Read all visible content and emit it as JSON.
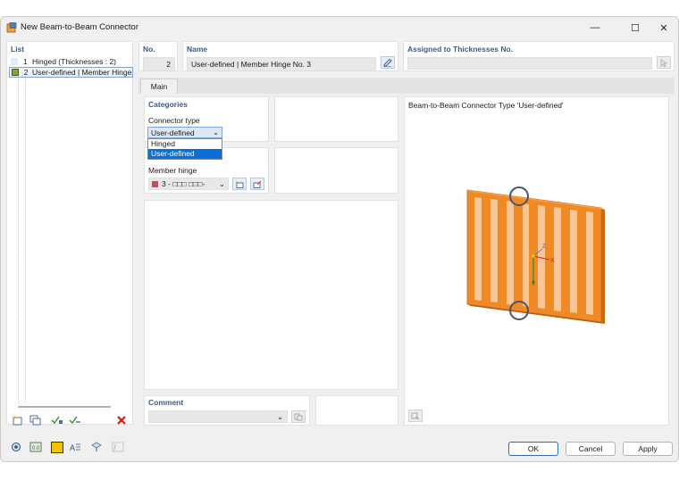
{
  "window": {
    "title": "New Beam-to-Beam Connector",
    "minimize_glyph": "—",
    "maximize_glyph": "☐",
    "close_glyph": "✕"
  },
  "list": {
    "title": "List",
    "items": [
      {
        "num": "1",
        "label": "Hinged (Thicknesses : 2)",
        "color": "#d9eef6"
      },
      {
        "num": "2",
        "label": "User-defined | Member Hinge N",
        "color": "#8aa428"
      }
    ]
  },
  "header": {
    "no_label": "No.",
    "no_value": "2",
    "name_label": "Name",
    "name_value": "User-defined | Member Hinge No. 3",
    "assigned_label": "Assigned to Thicknesses No.",
    "assigned_value": ""
  },
  "tabs": [
    {
      "label": "Main"
    }
  ],
  "categories": {
    "title": "Categories",
    "connector_type_label": "Connector type",
    "connector_type_value": "User-defined",
    "options": [
      "Hinged",
      "User-defined"
    ],
    "member_hinge_label": "Member hinge",
    "member_hinge_value": "3 - □□□ □□□-",
    "member_hinge_color": "#c0505a"
  },
  "comment": {
    "label": "Comment",
    "value": ""
  },
  "preview": {
    "title": "Beam-to-Beam Connector Type 'User-defined'",
    "axis_z": "Z",
    "axis_x": "X"
  },
  "buttons": {
    "ok": "OK",
    "cancel": "Cancel",
    "apply": "Apply"
  },
  "colors": {
    "accent": "#2f6fb5",
    "selection": "#0b6fd6",
    "orange": "#f08a24",
    "orange_light": "#f7c79a"
  }
}
